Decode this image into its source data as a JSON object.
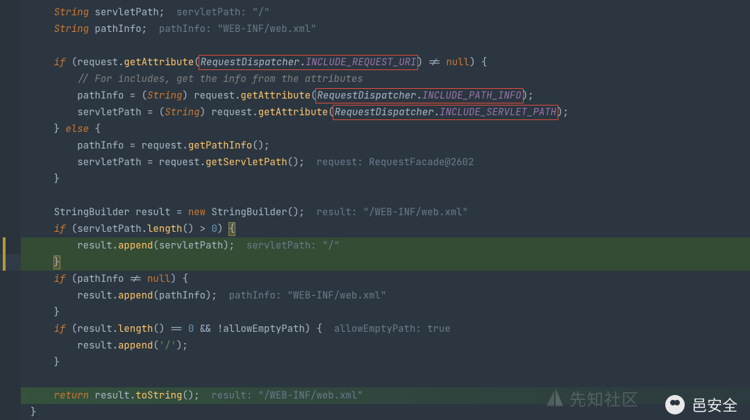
{
  "code": {
    "line1_a": "String",
    "line1_b": " servletPath;  ",
    "line1_hint": "servletPath: \"/\"",
    "line2_a": "String",
    "line2_b": " pathInfo;  ",
    "line2_hint": "pathInfo: \"WEB-INF/web.xml\"",
    "line4_if": "if",
    "line4_a": " (request.",
    "line4_m": "getAttribute",
    "line4_p1": "(",
    "line4_box_a": "RequestDispatcher",
    "line4_box_dot": ".",
    "line4_box_b": "INCLUDE_REQUEST_URI",
    "line4_p2": ") != ",
    "line4_null": "null",
    "line4_end": ") {",
    "line5_cmt": "// For includes, get the info from the attributes",
    "line6_a": "pathInfo = (",
    "line6_str": "String",
    "line6_b": ") request.",
    "line6_m": "getAttribute",
    "line6_p1": "(",
    "line6_box_a": "RequestDispatcher",
    "line6_box_dot": ".",
    "line6_box_b": "INCLUDE_PATH_INFO",
    "line6_end": ");",
    "line7_a": "servletPath = (",
    "line7_str": "String",
    "line7_b": ") request.",
    "line7_m": "getAttribute",
    "line7_p1": "(",
    "line7_box_a": "RequestDispatcher",
    "line7_box_dot": ".",
    "line7_box_b": "INCLUDE_SERVLET_PATH",
    "line7_end": ");",
    "line8_a": "} ",
    "line8_else": "else",
    "line8_b": " {",
    "line9_a": "pathInfo = request.",
    "line9_m": "getPathInfo",
    "line9_b": "();",
    "line10_a": "servletPath = request.",
    "line10_m": "getServletPath",
    "line10_b": "();  ",
    "line10_hint": "request: RequestFacade@2602",
    "line11": "}",
    "line13_a": "StringBuilder",
    "line13_b": " result = ",
    "line13_new": "new",
    "line13_c": " StringBuilder();  ",
    "line13_hint": "result: \"/WEB-INF/web.xml\"",
    "line14_if": "if",
    "line14_a": " (servletPath.",
    "line14_m": "length",
    "line14_b": "() > ",
    "line14_num": "0",
    "line14_c": ") ",
    "line14_brace": "{",
    "line15_a": "result.",
    "line15_m": "append",
    "line15_b": "(servletPath);  ",
    "line15_hint": "servletPath: \"/\"",
    "line16_brace": "}",
    "line17_if": "if",
    "line17_a": " (pathInfo != ",
    "line17_null": "null",
    "line17_b": ") {",
    "line18_a": "result.",
    "line18_m": "append",
    "line18_b": "(pathInfo);  ",
    "line18_hint": "pathInfo: \"WEB-INF/web.xml\"",
    "line19": "}",
    "line20_if": "if",
    "line20_a": " (result.",
    "line20_m": "length",
    "line20_b": "() == ",
    "line20_num": "0",
    "line20_c": " && !allowEmptyPath) {  ",
    "line20_hint": "allowEmptyPath: true",
    "line21_a": "result.",
    "line21_m": "append",
    "line21_b": "(",
    "line21_str": "'/'",
    "line21_c": ");",
    "line22": "}",
    "line24_ret": "return",
    "line24_a": " result.",
    "line24_m": "toString",
    "line24_b": "();  ",
    "line24_hint": "result: \"/WEB-INF/web.xml\"",
    "line25": "}"
  },
  "watermark_main": "邑安全",
  "watermark_bg": "先知社区"
}
